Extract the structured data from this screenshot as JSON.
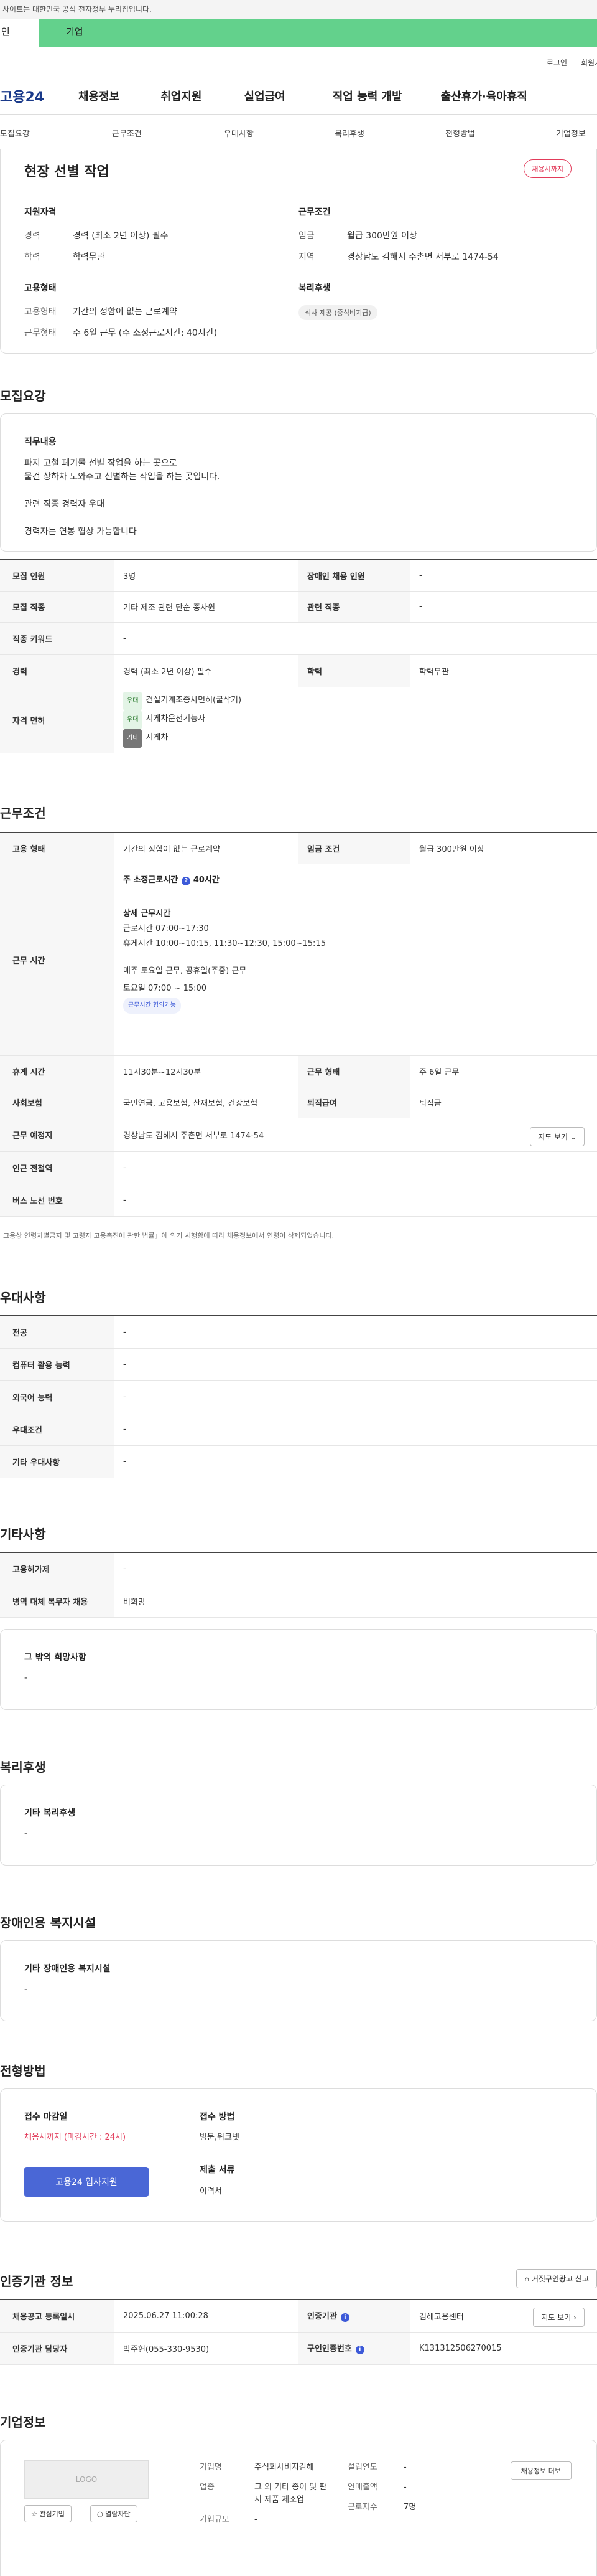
{
  "gov_banner": "사이트는 대한민국 공식 전자정부 누리집입니다.",
  "user_tabs": [
    "인",
    "기업"
  ],
  "util": [
    "로그인",
    "회원가"
  ],
  "logo": "고용24",
  "gnb": [
    "채용정보",
    "취업지원",
    "실업급여",
    "직업 능력 개발",
    "출산휴가·육아휴직"
  ],
  "subnav": [
    "모집요강",
    "근무조건",
    "우대사항",
    "복리후생",
    "전형방법",
    "기업정보"
  ],
  "summary": {
    "title": "현장 선별 작업",
    "badge": "채용시까지",
    "qual_head": "지원자격",
    "qual": [
      {
        "k": "경력",
        "v": "경력 (최소 2년 이상) 필수"
      },
      {
        "k": "학력",
        "v": "학력무관"
      }
    ],
    "emp_head": "고용형태",
    "emp": [
      {
        "k": "고용형태",
        "v": "기간의 정함이 없는 근로계약"
      },
      {
        "k": "근무형태",
        "v": "주 6일 근무 (주 소정근로시간: 40시간)"
      }
    ],
    "cond_head": "근무조건",
    "cond": [
      {
        "k": "임금",
        "v": "월급 300만원 이상"
      },
      {
        "k": "지역",
        "v": "경상남도 김해시 주촌면 서부로 1474-54"
      }
    ],
    "welfare_head": "복리후생",
    "welfare_tag": "식사 제공 (중식비지급)"
  },
  "recruit": {
    "title": "모집요강",
    "duty_head": "직무내용",
    "duty_lines": [
      "파지 고철 폐기물 선별 작업을 하는 곳으로",
      "물건 상하차 도와주고 선별하는 작업을 하는 곳입니다.",
      "관련 직종 경력자 우대",
      "경력자는 연봉 협상 가능합니다"
    ],
    "rows": {
      "count_k": "모집 인원",
      "count_v": "3명",
      "disabled_k": "장애인 채용 인원",
      "disabled_v": "-",
      "job_k": "모집 직종",
      "job_v": "기타 제조 관련 단순 종사원",
      "rel_k": "관련 직종",
      "rel_v": "-",
      "kw_k": "직종 키워드",
      "kw_v": "-",
      "exp_k": "경력",
      "exp_v": "경력 (최소 2년 이상) 필수",
      "edu_k": "학력",
      "edu_v": "학력무관",
      "lic_k": "자격 면허",
      "lic": [
        {
          "tag": "우대",
          "name": "건설기계조종사면허(굴삭기)"
        },
        {
          "tag": "우대",
          "name": "지게차운전기능사"
        },
        {
          "tag": "기타",
          "name": "지게차"
        }
      ]
    }
  },
  "work": {
    "title": "근무조건",
    "type_k": "고용 형태",
    "type_v": "기간의 정함이 없는 근로계약",
    "wage_k": "임금 조건",
    "wage_v": "월급 300만원 이상",
    "time_k": "근무 시간",
    "weekly": "주 소정근로시간",
    "weekly_v": "40시간",
    "detail_head": "상세 근무시간",
    "detail_lines": [
      "근로시간  07:00~17:30",
      "휴게시간  10:00~10:15, 11:30~12:30,  15:00~15:15"
    ],
    "sat_lines": [
      "매주 토요일 근무, 공휴일(주중) 근무",
      "토요일 07:00 ~ 15:00"
    ],
    "flex_tag": "근무시간 협의가능",
    "break_k": "휴게 시간",
    "break_v": "11시30분~12시30분",
    "form_k": "근무 형태",
    "form_v": "주 6일 근무",
    "ins_k": "사회보험",
    "ins_v": "국민연금, 고용보험, 산재보험, 건강보험",
    "ret_k": "퇴직급여",
    "ret_v": "퇴직금",
    "place_k": "근무 예정지",
    "place_v": "경상남도 김해시 주촌면 서부로 1474-54",
    "map_btn": "지도 보기",
    "subway_k": "인근 전철역",
    "subway_v": "-",
    "bus_k": "버스 노선 번호",
    "bus_v": "-",
    "note": "\"고용상 연령차별금지 및 고령자 고용촉진에 관한 법률」에 의거 시행함에 따라 채용정보에서 연령이 삭제되었습니다."
  },
  "pref": {
    "title": "우대사항",
    "rows": [
      {
        "k": "전공",
        "v": "-"
      },
      {
        "k": "컴퓨터 활용 능력",
        "v": "-"
      },
      {
        "k": "외국어 능력",
        "v": "-"
      },
      {
        "k": "우대조건",
        "v": "-"
      },
      {
        "k": "기타 우대사항",
        "v": "-"
      }
    ]
  },
  "etc": {
    "title": "기타사항",
    "rows": [
      {
        "k": "고용허가제",
        "v": "-"
      },
      {
        "k": "병역 대체 복무자 채용",
        "v": "비희망"
      }
    ],
    "other_head": "그 밖의 희망사항",
    "other_v": "-"
  },
  "welfare": {
    "title": "복리후생",
    "head": "기타 복리후생",
    "v": "-"
  },
  "disab": {
    "title": "장애인용 복지시설",
    "head": "기타 장애인용 복지시설",
    "v": "-"
  },
  "process": {
    "title": "전형방법",
    "deadline_k": "접수 마감일",
    "deadline_v": "채용시까지 (마감시간 : 24시)",
    "apply_btn": "고용24 입사지원",
    "method_k": "접수 방법",
    "method_v": "방문,워크넷",
    "docs_k": "제출 서류",
    "docs_v": "이력서"
  },
  "agency": {
    "title": "인증기관 정보",
    "report_btn": "거짓구인광고 신고",
    "reg_k": "채용공고 등록일시",
    "reg_v": "2025.06.27 11:00:28",
    "org_k": "인증기관",
    "org_v": "김해고용센터",
    "map_btn": "지도 보기",
    "mgr_k": "인증기관 담당자",
    "mgr_v": "박주현(055-330-9530)",
    "no_k": "구인인증번호",
    "no_v": "K131312506270015"
  },
  "company": {
    "title": "기업정보",
    "logo": "LOGO",
    "fav_btn": "관심기업",
    "block_btn": "열람차단",
    "name_k": "기업명",
    "name_v": "주식회사비지김해",
    "industry_k": "업종",
    "industry_v": "그 외 기타 종이 및 판지 제품 제조업",
    "size_k": "기업규모",
    "size_v": "-",
    "founded_k": "설립연도",
    "founded_v": "-",
    "sales_k": "연매출액",
    "sales_v": "-",
    "emp_k": "근로자수",
    "emp_v": "7명",
    "list_btn": "채용정보 더보"
  }
}
